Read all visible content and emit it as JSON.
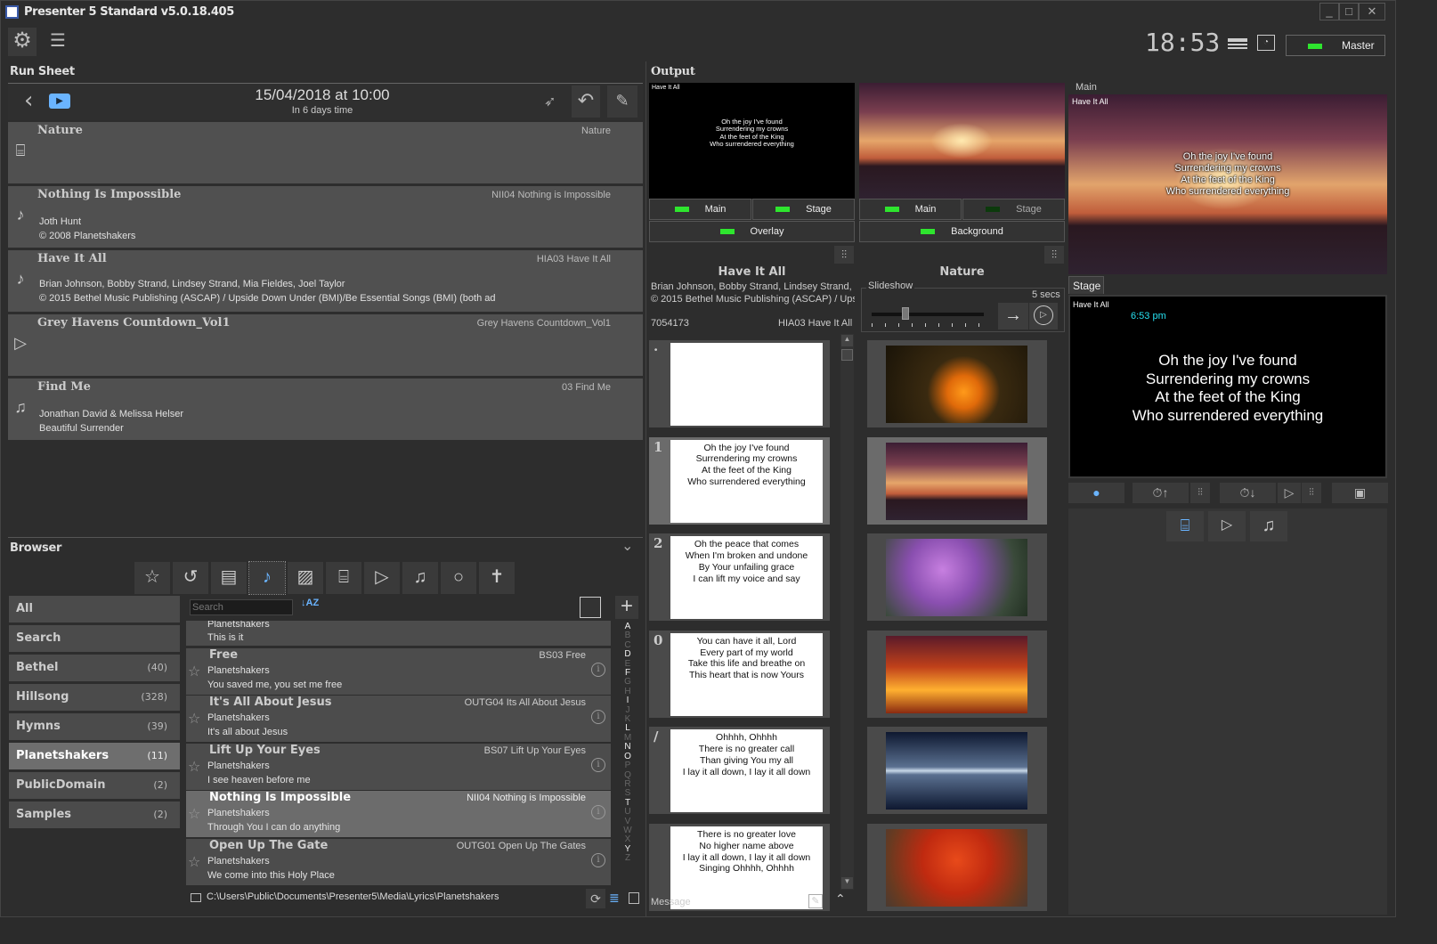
{
  "window": {
    "title": "Presenter 5 Standard  v5.0.18.405",
    "controls": {
      "minimize": "_",
      "maximize": "□",
      "close": "✕"
    }
  },
  "toolbar": {
    "settings_icon": "⚙",
    "menu_icon": "☰",
    "clock": "18:53",
    "master_label": "Master",
    "master_led": "#2ee52e"
  },
  "run_sheet": {
    "header": "Run Sheet",
    "date": "15/04/2018 at 10:00",
    "relative": "In 6 days time",
    "items": [
      {
        "title": "Nature",
        "right": "Nature",
        "line1": "",
        "line2": "",
        "icon": "presentation-icon"
      },
      {
        "title": "Nothing Is Impossible",
        "right": "NII04 Nothing is Impossible",
        "line1": "Joth Hunt",
        "line2": "© 2008 Planetshakers",
        "icon": "song-icon"
      },
      {
        "title": "Have It All",
        "right": "HIA03 Have It All",
        "line1": "Brian Johnson, Bobby Strand, Lindsey Strand, Mia Fieldes, Joel Taylor",
        "line2": "© 2015 Bethel Music Publishing (ASCAP) / Upside Down Under (BMI)/Be Essential Songs (BMI) (both ad",
        "icon": "song-icon"
      },
      {
        "title": "Grey Havens Countdown_Vol1",
        "right": "Grey Havens Countdown_Vol1",
        "line1": "",
        "line2": "",
        "icon": "video-icon"
      },
      {
        "title": "Find Me",
        "right": "03 Find Me",
        "line1": "Jonathan David & Melissa Helser",
        "line2": "Beautiful Surrender",
        "icon": "music-icon"
      }
    ]
  },
  "browser": {
    "header": "Browser",
    "search_placeholder": "Search",
    "categories": [
      {
        "name": "All",
        "count": ""
      },
      {
        "name": "Search",
        "count": ""
      },
      {
        "name": "Bethel",
        "count": "(40)"
      },
      {
        "name": "Hillsong",
        "count": "(328)"
      },
      {
        "name": "Hymns",
        "count": "(39)"
      },
      {
        "name": "Planetshakers",
        "count": "(11)"
      },
      {
        "name": "PublicDomain",
        "count": "(2)"
      },
      {
        "name": "Samples",
        "count": "(2)"
      }
    ],
    "selected_category": "Planetshakers",
    "partial_song": {
      "author": "Planetshakers",
      "first_line": "This is it"
    },
    "songs": [
      {
        "title": "Free",
        "code": "BS03 Free",
        "author": "Planetshakers",
        "first_line": "You saved me, you set me free"
      },
      {
        "title": "It's All About Jesus",
        "code": "OUTG04 Its All About Jesus",
        "author": "Planetshakers",
        "first_line": "It's all about Jesus"
      },
      {
        "title": "Lift Up Your Eyes",
        "code": "BS07 Lift Up Your Eyes",
        "author": "Planetshakers",
        "first_line": "I see heaven before me"
      },
      {
        "title": "Nothing Is Impossible",
        "code": "NII04 Nothing is Impossible",
        "author": "Planetshakers",
        "first_line": "Through You I can do anything"
      },
      {
        "title": "Open Up The Gate",
        "code": "OUTG01 Open Up The Gates",
        "author": "Planetshakers",
        "first_line": "We come into this Holy Place"
      }
    ],
    "alphabet": [
      "A",
      "B",
      "C",
      "D",
      "E",
      "F",
      "G",
      "H",
      "I",
      "J",
      "K",
      "L",
      "M",
      "N",
      "O",
      "P",
      "Q",
      "R",
      "S",
      "T",
      "U",
      "V",
      "W",
      "X",
      "Y",
      "Z"
    ],
    "alphabet_active": [
      "A",
      "D",
      "F",
      "I",
      "L",
      "N",
      "O",
      "T",
      "Y"
    ],
    "path": "C:\\Users\\Public\\Documents\\Presenter5\\Media\\Lyrics\\Planetshakers"
  },
  "output": {
    "header": "Output",
    "preview_title": "Have It All",
    "preview_lyrics": [
      "Oh the joy I've found",
      "Surrendering my crowns",
      "At the feet of the King",
      "Who surrendered everything"
    ],
    "fg_buttons": {
      "main": "Main",
      "stage": "Stage",
      "overlay": "Overlay"
    },
    "bg_buttons": {
      "main": "Main",
      "stage": "Stage",
      "background": "Background"
    },
    "song": {
      "title": "Have It All",
      "authors": "Brian Johnson, Bobby Strand, Lindsey Strand, Mia",
      "copyright": "© 2015 Bethel Music Publishing (ASCAP) / Upside",
      "ccli": "7054173",
      "code": "HIA03 Have It All"
    },
    "slides": [
      {
        "key": "·",
        "lines": []
      },
      {
        "key": "1",
        "lines": [
          "Oh the joy I've found",
          "Surrendering my crowns",
          "At the feet of the King",
          "Who surrendered everything"
        ]
      },
      {
        "key": "2",
        "lines": [
          "Oh the peace that comes",
          "When I'm broken and undone",
          "By Your unfailing grace",
          "I can lift my voice and say"
        ]
      },
      {
        "key": "0",
        "lines": [
          "You can have it all, Lord",
          "Every part of my world",
          "Take this life and breathe on",
          "This heart that is now Yours"
        ]
      },
      {
        "key": "/",
        "lines": [
          "Ohhhh, Ohhhh",
          "There is no greater call",
          "Than giving You my all",
          "I lay it all down, I lay it all down"
        ]
      },
      {
        "key": "",
        "lines": [
          "There is no greater love",
          "No higher name above",
          "I lay it all down, I lay it all down",
          "Singing Ohhhh, Ohhhh"
        ]
      }
    ],
    "current_slide": 1,
    "message_label": "Message",
    "background": {
      "title": "Nature",
      "slideshow_label": "Slideshow",
      "interval": "5 secs",
      "slider_position": 0.3,
      "thumbnails": [
        "butterfly-flower",
        "sunset-clouds",
        "purple-garden",
        "autumn-tree",
        "tree-reflection",
        "red-autumn-park"
      ],
      "current_thumbnail": 1
    }
  },
  "monitors": {
    "main_label": "Main",
    "main_title": "Have It All",
    "stage_tab": "Stage",
    "stage_title": "Have It All",
    "stage_time": "6:53 pm",
    "stage_time_color": "#27e0f0",
    "lyrics": [
      "Oh the joy I've found",
      "Surrendering my crowns",
      "At the feet of the King",
      "Who surrendered everything"
    ]
  }
}
